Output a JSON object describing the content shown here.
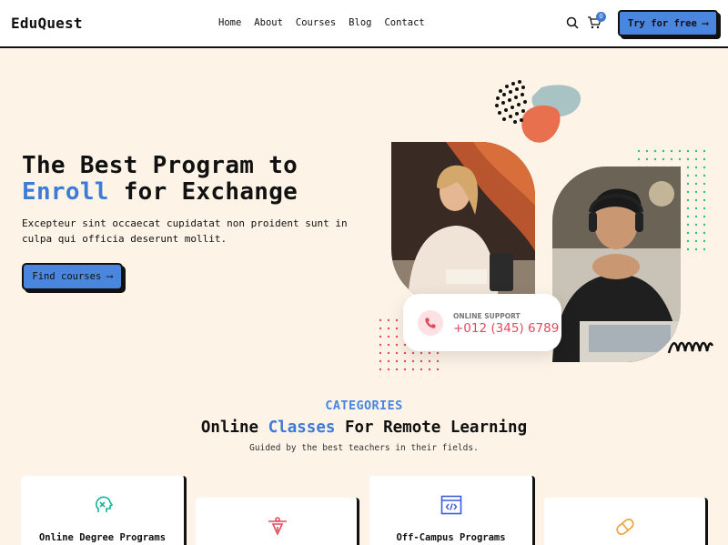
{
  "header": {
    "logo": "EduQuest",
    "nav": [
      "Home",
      "About",
      "Courses",
      "Blog",
      "Contact"
    ],
    "cart_count": "0",
    "try_button": "Try for free"
  },
  "hero": {
    "title_line1": "The Best Program to",
    "title_accent": "Enroll",
    "title_line2_rest": " for Exchange",
    "description": "Excepteur sint occaecat cupidatat non proident sunt in culpa qui officia deserunt mollit.",
    "cta": "Find courses"
  },
  "support": {
    "label": "ONLINE SUPPORT",
    "phone": "+012 (345) 6789"
  },
  "categories": {
    "kicker": "CATEGORIES",
    "title_pre": "Online ",
    "title_accent": "Classes",
    "title_post": " For Remote Learning",
    "subtitle": "Guided by the best teachers in their fields.",
    "cards": [
      {
        "label": "Online Degree Programs",
        "icon": "brain-head-icon"
      },
      {
        "label": "",
        "icon": "pen-tool-icon"
      },
      {
        "label": "Off-Campus Programs",
        "icon": "code-window-icon"
      },
      {
        "label": "",
        "icon": "capsule-icon"
      }
    ]
  },
  "colors": {
    "accent": "#3d7bd6",
    "background": "#fdf3e7",
    "phone_red": "#e24b5e"
  }
}
